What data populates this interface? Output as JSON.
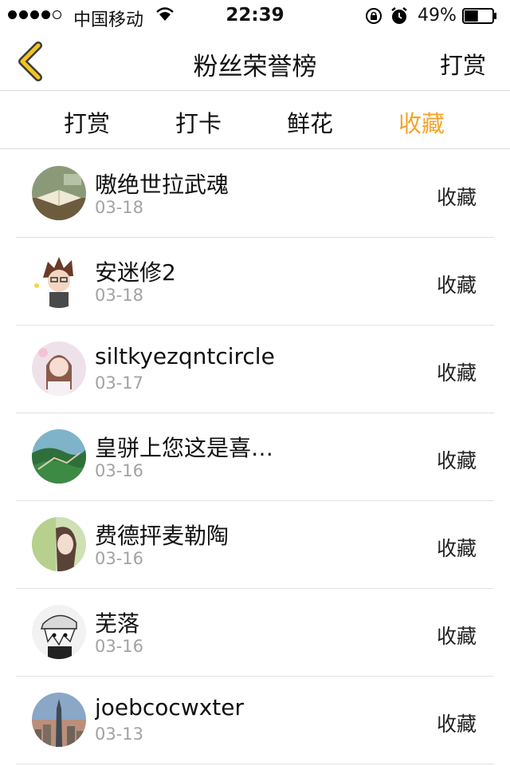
{
  "status_bar": {
    "carrier": "中国移动",
    "time": "22:39",
    "battery": "49%",
    "battery_level": 0.49,
    "signal_bars": 4,
    "signal_max": 5
  },
  "nav": {
    "title": "粉丝荣誉榜",
    "right_label": "打赏",
    "back_icon": "chevron-left-icon",
    "accent_color": "#f4c51a"
  },
  "tabs": [
    {
      "label": "打赏",
      "active": false
    },
    {
      "label": "打卡",
      "active": false
    },
    {
      "label": "鲜花",
      "active": false
    },
    {
      "label": "收藏",
      "active": true
    }
  ],
  "active_tab_color": "#f4a52a",
  "list": [
    {
      "name": "嗷绝世拉武魂",
      "date": "03-18",
      "action": "收藏",
      "avatar": "book-photo"
    },
    {
      "name": "安迷修2",
      "date": "03-18",
      "action": "收藏",
      "avatar": "anime-boy"
    },
    {
      "name": "siltkyezqntcircle",
      "date": "03-17",
      "action": "收藏",
      "avatar": "girl-photo"
    },
    {
      "name": "皇骈上您这是喜…",
      "date": "03-16",
      "action": "收藏",
      "avatar": "great-wall"
    },
    {
      "name": "费德抨麦勒陶",
      "date": "03-16",
      "action": "收藏",
      "avatar": "woman-portrait"
    },
    {
      "name": "芜落",
      "date": "03-16",
      "action": "收藏",
      "avatar": "manga-character"
    },
    {
      "name": "joebcocwxter",
      "date": "03-13",
      "action": "收藏",
      "avatar": "city-tower"
    }
  ]
}
